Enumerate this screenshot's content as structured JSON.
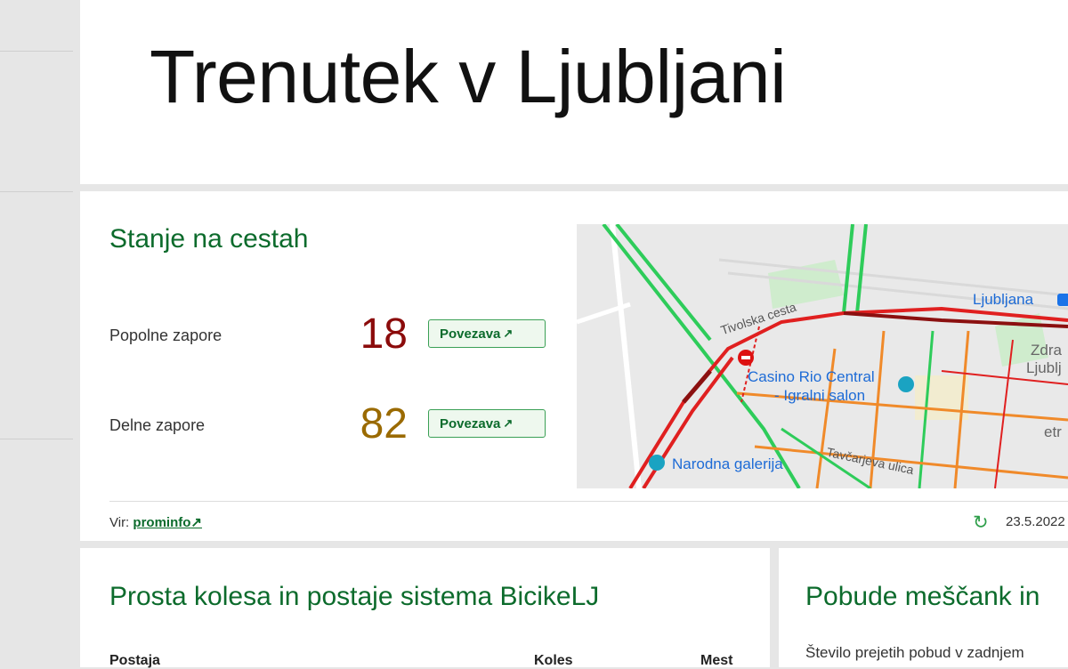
{
  "header": {
    "title": "Trenutek v Ljubljani"
  },
  "traffic": {
    "title": "Stanje na cestah",
    "metrics": [
      {
        "label": "Popolne zapore",
        "value": "18",
        "link_label": "Povezava"
      },
      {
        "label": "Delne zapore",
        "value": "82",
        "link_label": "Povezava"
      }
    ],
    "link_arrow": "↗",
    "map": {
      "labels": {
        "station": "Ljubljana",
        "street_1": "Tivolska cesta",
        "poi_1_line1": "Casino Rio Central",
        "poi_1_line2": "- Igralni salon",
        "poi_2": "Narodna galerija",
        "street_2": "Tavčarjeva ulica",
        "partial_1": "Zdra",
        "partial_2": "Ljublj",
        "partial_3": "etr"
      }
    },
    "source_prefix": "Vir:",
    "source_link": "prominfo",
    "timestamp": "23.5.2022"
  },
  "bike": {
    "title": "Prosta kolesa in postaje sistema BicikeLJ",
    "columns": [
      "Postaja",
      "Koles",
      "Mest"
    ]
  },
  "civic": {
    "title": "Pobude meščank in",
    "text": "Število prejetih pobud v zadnjem"
  },
  "colors": {
    "brand_green": "#0c6b2c",
    "closure_red": "#8b0b0b",
    "partial_amber": "#9a6a00"
  }
}
